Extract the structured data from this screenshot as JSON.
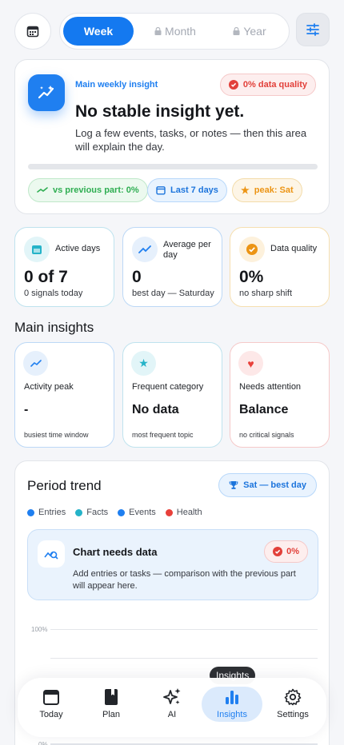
{
  "period_tabs": [
    {
      "label": "Week",
      "active": true,
      "locked": false
    },
    {
      "label": "Month",
      "active": false,
      "locked": true
    },
    {
      "label": "Year",
      "active": false,
      "locked": true
    }
  ],
  "hero": {
    "kicker": "Main weekly insight",
    "quality_badge": "0% data quality",
    "title": "No stable insight yet.",
    "text": "Log a few events, tasks, or notes — then this area will explain the day.",
    "progress": 0,
    "chips": {
      "comparison": "vs previous part: 0%",
      "range": "Last 7 days",
      "peak": "peak: Sat"
    }
  },
  "stats": [
    {
      "label": "Active days",
      "value": "0 of 7",
      "sub": "0 signals today",
      "icon": "calendar-icon"
    },
    {
      "label": "Average per day",
      "value": "0",
      "sub": "best day — Saturday",
      "icon": "trend-icon"
    },
    {
      "label": "Data quality",
      "value": "0%",
      "sub": "no sharp shift",
      "icon": "check-badge-icon"
    }
  ],
  "main_insights": {
    "title": "Main insights",
    "cards": [
      {
        "label": "Activity peak",
        "value": "-",
        "sub": "busiest time window",
        "icon": "trend-icon"
      },
      {
        "label": "Frequent category",
        "value": "No data",
        "sub": "most frequent topic",
        "icon": "star-icon"
      },
      {
        "label": "Needs attention",
        "value": "Balance",
        "sub": "no critical signals",
        "icon": "heart-icon"
      }
    ]
  },
  "trend": {
    "title": "Period trend",
    "best_badge": "Sat — best day",
    "legend": [
      {
        "name": "Entries",
        "color": "#1f7ff0"
      },
      {
        "name": "Facts",
        "color": "#25b3c8"
      },
      {
        "name": "Events",
        "color": "#1f7ff0"
      },
      {
        "name": "Health",
        "color": "#e8403a"
      }
    ],
    "notice": {
      "title": "Chart needs data",
      "badge": "0%",
      "text": "Add entries or tasks — comparison with the previous part will appear here."
    },
    "y_axis_top": "100%",
    "y_axis_bottom": "0%"
  },
  "tooltip": "Insights",
  "tabbar": [
    {
      "label": "Today",
      "icon": "calendar-icon",
      "active": false
    },
    {
      "label": "Plan",
      "icon": "book-icon",
      "active": false
    },
    {
      "label": "AI",
      "icon": "sparkle-icon",
      "active": false
    },
    {
      "label": "Insights",
      "icon": "bar-chart-icon",
      "active": true
    },
    {
      "label": "Settings",
      "icon": "gear-icon",
      "active": false
    }
  ],
  "colors": {
    "accent": "#1f7ff0",
    "danger": "#e2403a",
    "success": "#2fae52",
    "warning": "#ec9414"
  }
}
